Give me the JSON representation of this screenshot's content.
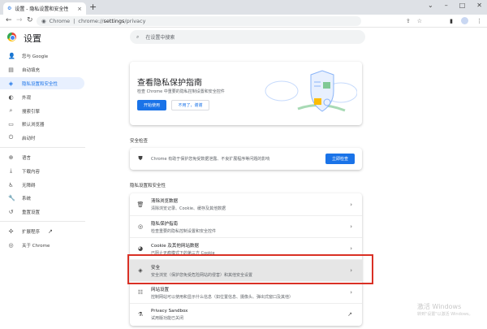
{
  "tab": {
    "title": "设置 - 隐私设置和安全性",
    "close": "×",
    "new_tab": "+"
  },
  "window": {
    "minimize": "–",
    "maximize": "□",
    "close": "✕",
    "tab_search": "⌄"
  },
  "address": {
    "site": "Chrome",
    "url_prefix": "chrome://",
    "url_host": "settings",
    "url_path": "/privacy"
  },
  "header": {
    "title": "设置",
    "search_placeholder": "在设置中搜索"
  },
  "sidebar": {
    "items": [
      {
        "label": "您与 Google",
        "icon": "person-icon"
      },
      {
        "label": "自动填充",
        "icon": "clipboard-icon"
      },
      {
        "label": "隐私设置和安全性",
        "icon": "shield-icon",
        "active": true
      },
      {
        "label": "外观",
        "icon": "palette-icon"
      },
      {
        "label": "搜索引擎",
        "icon": "search-icon"
      },
      {
        "label": "默认浏览器",
        "icon": "browser-icon"
      },
      {
        "label": "启动时",
        "icon": "power-icon"
      },
      {
        "label": "语言",
        "icon": "globe-icon"
      },
      {
        "label": "下载内容",
        "icon": "download-icon"
      },
      {
        "label": "无障碍",
        "icon": "accessibility-icon"
      },
      {
        "label": "系统",
        "icon": "wrench-icon"
      },
      {
        "label": "重置设置",
        "icon": "reset-icon"
      },
      {
        "label": "扩展程序",
        "icon": "puzzle-icon"
      },
      {
        "label": "关于 Chrome",
        "icon": "chrome-icon"
      }
    ]
  },
  "guide": {
    "title": "查看隐私保护指南",
    "subtitle": "检查 Chrome 中重要的隐私控制设置和安全控件",
    "start": "开始使用",
    "dismiss": "不用了，谢谢"
  },
  "safety": {
    "section": "安全检查",
    "text": "Chrome 有助于保护您免受数据泄露、不良扩展程序等问题的影响",
    "button": "立即检查"
  },
  "privacy": {
    "section": "隐私设置和安全性",
    "rows": [
      {
        "title": "清除浏览数据",
        "desc": "清除浏览记录、Cookie、缓存及其他数据"
      },
      {
        "title": "隐私保护指南",
        "desc": "检查重要的隐私控制设置和安全控件"
      },
      {
        "title": "Cookie 及其他网站数据",
        "desc": "已阻止无痕模式下的第三方 Cookie"
      },
      {
        "title": "安全",
        "desc": "安全浏览（保护您免受危险网站的侵害）和其他安全设置"
      },
      {
        "title": "网站设置",
        "desc": "控制网站可以使用和显示什么信息（如位置信息、摄像头、弹出式窗口及其他）"
      },
      {
        "title": "Privacy Sandbox",
        "desc": "试用版功能已关闭"
      }
    ]
  },
  "watermark": {
    "line1": "激活 Windows",
    "line2": "转到\"设置\"以激活 Windows。"
  }
}
